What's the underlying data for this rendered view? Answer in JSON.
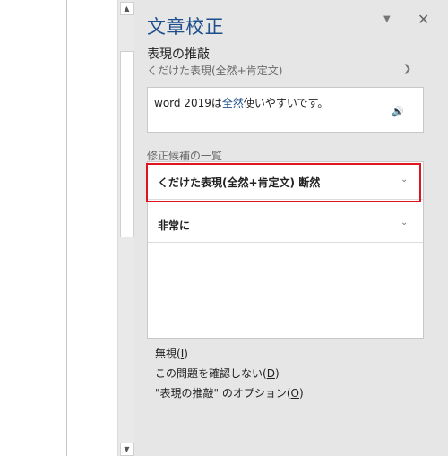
{
  "pane": {
    "title": "文章校正",
    "options_icon": "dropdown-triangle-icon",
    "close_icon": "close-icon",
    "heading": "表現の推敲",
    "sub_heading": "くだけた表現(全然+肯定文)",
    "sentence": {
      "before": "word 2019は",
      "error": "全然",
      "after": "使いやすいです。"
    },
    "suggestions_label": "修正候補の一覧",
    "suggestions": [
      "くだけた表現(全然+肯定文) 断然",
      "非常に"
    ],
    "links": {
      "ignore_label": "無視(",
      "ignore_key": "I",
      "ignore_close": ")",
      "dont_check_label": "この問題を確認しない(",
      "dont_check_key": "D",
      "dont_check_close": ")",
      "options_label": "\"表現の推敲\" のオプション(",
      "options_key": "O",
      "options_close": ")"
    }
  },
  "colors": {
    "accent": "#1e4e8c",
    "highlight": "#e0141f",
    "pane_bg": "#e6e6e6"
  }
}
